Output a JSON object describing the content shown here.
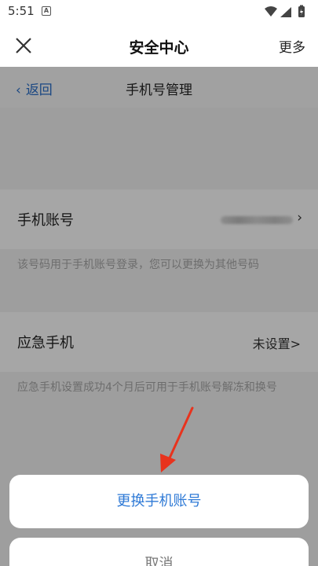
{
  "status_bar": {
    "time": "5:51",
    "notification_glyph": "A"
  },
  "header": {
    "title": "安全中心",
    "more_label": "更多"
  },
  "subnav": {
    "back_label": "返回",
    "title": "手机号管理"
  },
  "phone_row": {
    "label": "手机账号"
  },
  "phone_note": "该号码用于手机账号登录，您可以更换为其他号码",
  "emergency_row": {
    "label": "应急手机",
    "value": "未设置>"
  },
  "emergency_note": "应急手机设置成功4个月后可用于手机账号解冻和换号",
  "sheet": {
    "primary_label": "更换手机账号",
    "cancel_label": "取消"
  },
  "colors": {
    "accent": "#2f7ad6",
    "arrow": "#e8331d"
  }
}
